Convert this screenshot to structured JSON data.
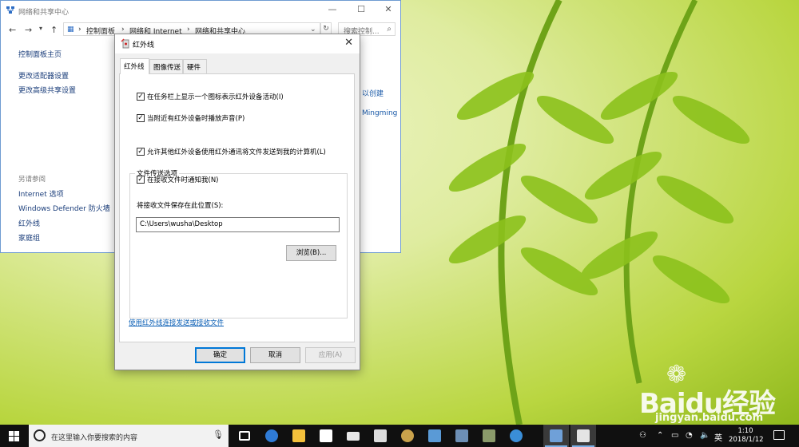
{
  "control_panel": {
    "title": "网络和共享中心",
    "breadcrumb": [
      "控制面板",
      "网络和 Internet",
      "网络和共享中心"
    ],
    "search_placeholder": "搜索控制...",
    "sidebar_links": [
      "控制面板主页",
      "更改适配器设置",
      "更改高级共享设置"
    ],
    "see_also_label": "另请参阅",
    "see_also_links": [
      "Internet 选项",
      "Windows Defender 防火墙",
      "红外线",
      "家庭组"
    ],
    "peek_text": [
      "以创建",
      "Mingming"
    ]
  },
  "dialog": {
    "title": "红外线",
    "tabs": [
      "红外线",
      "图像传送",
      "硬件"
    ],
    "active_tab": "红外线",
    "checkboxes": [
      {
        "label": "在任务栏上显示一个图标表示红外设备活动(I)",
        "checked": true
      },
      {
        "label": "当附近有红外设备时播放声音(P)",
        "checked": true
      }
    ],
    "group_title": "文件传送选项",
    "group_checkboxes": [
      {
        "label": "允许其他红外设备使用红外通讯将文件发送到我的计算机(L)",
        "checked": true
      },
      {
        "label": "在接收文件时通知我(N)",
        "checked": true
      }
    ],
    "save_location_label": "将接收文件保存在此位置(S):",
    "save_location_value": "C:\\Users\\wusha\\Desktop",
    "browse_button": "浏览(B)...",
    "help_link": "使用红外线连接发送或接收文件",
    "ok_button": "确定",
    "cancel_button": "取消",
    "apply_button": "应用(A)"
  },
  "taskbar": {
    "search_placeholder": "在这里输入你要搜索的内容",
    "time": "1:10",
    "date": "2018/1/12",
    "ime": "英",
    "apps": [
      "task-view",
      "edge",
      "file-explorer",
      "store",
      "mail",
      "calculator",
      "paint",
      "network-app",
      "monitor",
      "photos",
      "ie",
      "control-panel",
      "ir-dialog"
    ]
  },
  "watermark": {
    "brand": "Baidu经验",
    "url": "jingyan.baidu.com"
  },
  "colors": {
    "accent": "#0078d7",
    "link": "#0b5fb5",
    "taskbar": "#101010"
  }
}
